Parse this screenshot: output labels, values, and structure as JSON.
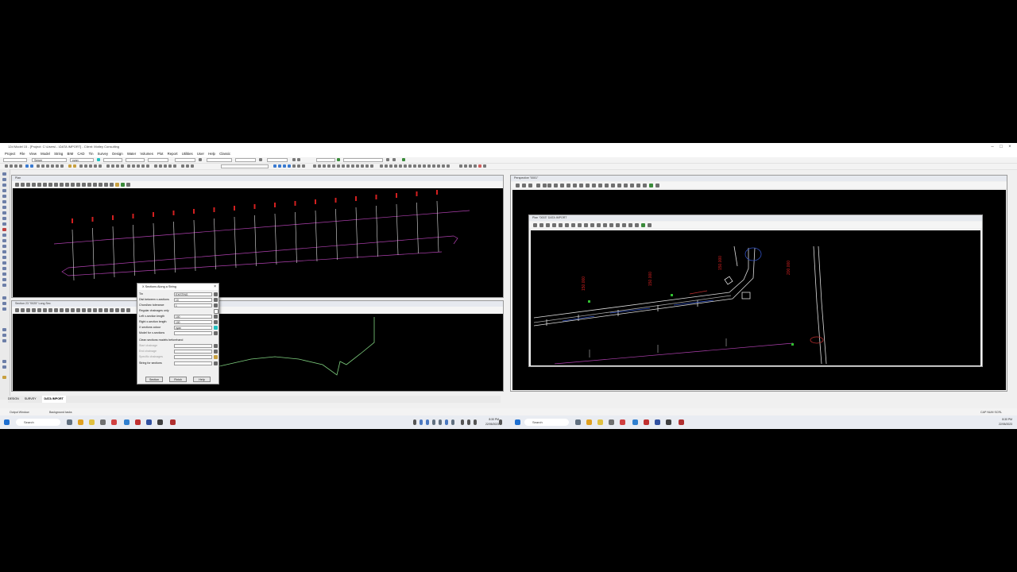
{
  "app": {
    "title": "12d Model 15 - [Project: C:\\Users\\...\\DATA IMPORT] - Client: Motley Consulting",
    "menu": [
      "Project",
      "File",
      "View",
      "Model",
      "String",
      "BIM",
      "CAD",
      "Tin",
      "Survey",
      "Design",
      "Water",
      "Volumes",
      "Plot",
      "Report",
      "Utilities",
      "User",
      "Help",
      "Classic"
    ],
    "combo_values": [
      "",
      "Sewer",
      "cyan"
    ]
  },
  "views": {
    "plan_top": {
      "title": "Plan"
    },
    "section_bottom": {
      "title": "Section 23 \"0025\" Long Sec"
    },
    "right_back": {
      "title": "Perspective \"0001\""
    },
    "right_front": {
      "title": "Plan \"0003\" DATA IMPORT"
    }
  },
  "labels": {
    "chainages": [
      "150.000",
      "150.000",
      "150.000",
      "200.000"
    ]
  },
  "dialog": {
    "title": "X Sections Along a String",
    "rows": [
      {
        "label": "Tin",
        "value": "EXISTING",
        "disabled": false
      },
      {
        "label": "Dist between x-sections",
        "value": "10",
        "disabled": false
      },
      {
        "label": "Chord/arc tolerance",
        "value": "1",
        "disabled": false
      },
      {
        "label": "Regular chainages only",
        "value": null,
        "disabled": false
      },
      {
        "label": "Left x-section length",
        "value": "100",
        "disabled": false
      },
      {
        "label": "Right x-section length",
        "value": "100",
        "disabled": false
      },
      {
        "label": "X sections colour",
        "value": "cyan",
        "disabled": false
      },
      {
        "label": "Model for x-sections",
        "value": "",
        "disabled": false
      },
      {
        "label": "Clean sections models beforehand",
        "value": null,
        "disabled": false
      },
      {
        "label": "Start chainage",
        "value": "",
        "disabled": true
      },
      {
        "label": "End chainage",
        "value": "",
        "disabled": true
      },
      {
        "label": "Specific chainages",
        "value": "",
        "disabled": true
      },
      {
        "label": "String for sections",
        "value": "",
        "disabled": false
      }
    ],
    "buttons": [
      "Section",
      "Finish",
      "Help"
    ]
  },
  "tabs": [
    "DESIGN",
    "SURVEY",
    "DATA IMPORT"
  ],
  "status": {
    "left1": "Output Window",
    "left2": "Background tasks",
    "caps": "CAP  NUM  SCRL"
  },
  "taskbar": {
    "search_left": "Search",
    "search_right": "Search",
    "time_left": "8:30 PM",
    "date_left": "22/05/2023",
    "time_right": "8:30 PM",
    "date_right": "22/05/2023"
  },
  "colors": {
    "magenta": "#b040b0",
    "red": "#d42020",
    "cyan": "#20c0c0",
    "green": "#7fd07f"
  }
}
